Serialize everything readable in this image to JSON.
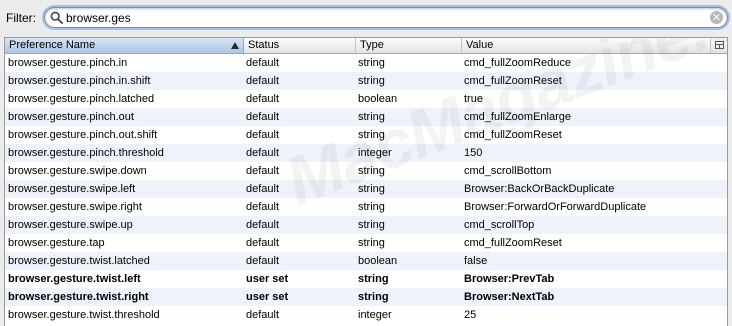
{
  "filter": {
    "label": "Filter:",
    "value": "browser.ges"
  },
  "columns": {
    "name": "Preference Name",
    "status": "Status",
    "type": "Type",
    "value": "Value"
  },
  "rows": [
    {
      "name": "browser.gesture.pinch.in",
      "status": "default",
      "type": "string",
      "value": "cmd_fullZoomReduce",
      "bold": false
    },
    {
      "name": "browser.gesture.pinch.in.shift",
      "status": "default",
      "type": "string",
      "value": "cmd_fullZoomReset",
      "bold": false
    },
    {
      "name": "browser.gesture.pinch.latched",
      "status": "default",
      "type": "boolean",
      "value": "true",
      "bold": false
    },
    {
      "name": "browser.gesture.pinch.out",
      "status": "default",
      "type": "string",
      "value": "cmd_fullZoomEnlarge",
      "bold": false
    },
    {
      "name": "browser.gesture.pinch.out.shift",
      "status": "default",
      "type": "string",
      "value": "cmd_fullZoomReset",
      "bold": false
    },
    {
      "name": "browser.gesture.pinch.threshold",
      "status": "default",
      "type": "integer",
      "value": "150",
      "bold": false
    },
    {
      "name": "browser.gesture.swipe.down",
      "status": "default",
      "type": "string",
      "value": "cmd_scrollBottom",
      "bold": false
    },
    {
      "name": "browser.gesture.swipe.left",
      "status": "default",
      "type": "string",
      "value": "Browser:BackOrBackDuplicate",
      "bold": false
    },
    {
      "name": "browser.gesture.swipe.right",
      "status": "default",
      "type": "string",
      "value": "Browser:ForwardOrForwardDuplicate",
      "bold": false
    },
    {
      "name": "browser.gesture.swipe.up",
      "status": "default",
      "type": "string",
      "value": "cmd_scrollTop",
      "bold": false
    },
    {
      "name": "browser.gesture.tap",
      "status": "default",
      "type": "string",
      "value": "cmd_fullZoomReset",
      "bold": false
    },
    {
      "name": "browser.gesture.twist.latched",
      "status": "default",
      "type": "boolean",
      "value": "false",
      "bold": false
    },
    {
      "name": "browser.gesture.twist.left",
      "status": "user set",
      "type": "string",
      "value": "Browser:PrevTab",
      "bold": true
    },
    {
      "name": "browser.gesture.twist.right",
      "status": "user set",
      "type": "string",
      "value": "Browser:NextTab",
      "bold": true
    },
    {
      "name": "browser.gesture.twist.threshold",
      "status": "default",
      "type": "integer",
      "value": "25",
      "bold": false
    }
  ],
  "icons": {
    "search": "search-icon",
    "clear": "clear-icon",
    "sort": "sort-ascending-icon",
    "column_picker": "column-picker-icon"
  },
  "watermark": "MacMagazine.com.br",
  "colors": {
    "row_alt": "#eef3fb",
    "header_sorted": "#a9c4e6",
    "focus_ring": "#9ec3ea"
  }
}
